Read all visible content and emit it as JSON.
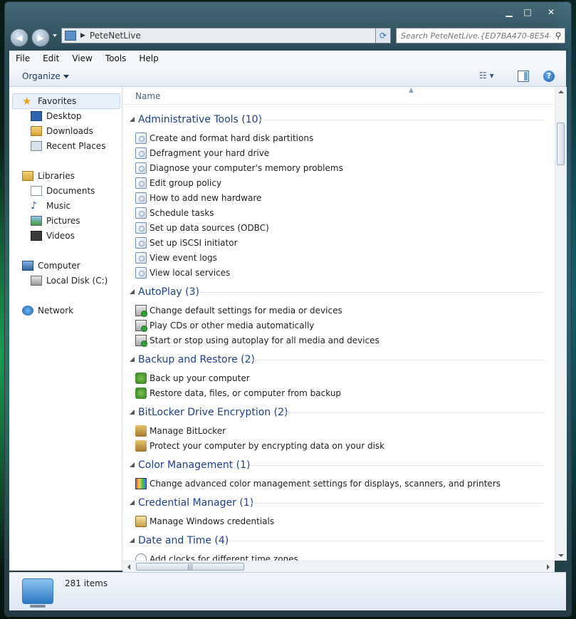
{
  "window": {
    "caption_buttons": {
      "minimize": "▁",
      "maximize": "□",
      "close": "✕"
    }
  },
  "navigation": {
    "back_label": "◀",
    "forward_label": "▶",
    "address": "PeteNetLive",
    "address_separator": "▶",
    "refresh_label": "⟳",
    "search_placeholder": "Search PeteNetLive.{ED7BA470-8E54-...",
    "search_icon": "⚲"
  },
  "menubar": {
    "items": [
      "File",
      "Edit",
      "View",
      "Tools",
      "Help"
    ]
  },
  "toolbar": {
    "organize_label": "Organize",
    "views_label": "☷ ▾",
    "help_label": "?"
  },
  "sidebar": {
    "favorites": "Favorites",
    "desktop": "Desktop",
    "downloads": "Downloads",
    "recent_places": "Recent Places",
    "libraries": "Libraries",
    "documents": "Documents",
    "music": "Music",
    "pictures": "Pictures",
    "videos": "Videos",
    "computer": "Computer",
    "local_disk": "Local Disk (C:)",
    "network": "Network"
  },
  "content": {
    "column_name": "Name",
    "groups": [
      {
        "title": "Administrative Tools (10)",
        "icon": "admin-tools-icon",
        "items": [
          "Create and format hard disk partitions",
          "Defragment your hard drive",
          "Diagnose your computer's memory problems",
          "Edit group policy",
          "How to add new hardware",
          "Schedule tasks",
          "Set up data sources (ODBC)",
          "Set up iSCSI initiator",
          "View event logs",
          "View local services"
        ]
      },
      {
        "title": "AutoPlay (3)",
        "icon": "autoplay-icon",
        "items": [
          "Change default settings for media or devices",
          "Play CDs or other media automatically",
          "Start or stop using autoplay for all media and devices"
        ]
      },
      {
        "title": "Backup and Restore (2)",
        "icon": "backup-icon",
        "items": [
          "Back up your computer",
          "Restore data, files, or computer from backup"
        ]
      },
      {
        "title": "BitLocker Drive Encryption (2)",
        "icon": "bitlocker-icon",
        "items": [
          "Manage BitLocker",
          "Protect your computer by encrypting data on your disk"
        ]
      },
      {
        "title": "Color Management (1)",
        "icon": "color-management-icon",
        "items": [
          "Change advanced color management settings for displays, scanners, and printers"
        ]
      },
      {
        "title": "Credential Manager (1)",
        "icon": "credential-icon",
        "items": [
          "Manage Windows credentials"
        ]
      },
      {
        "title": "Date and Time (4)",
        "icon": "clock-icon",
        "items": [
          "Add clocks for different time zones"
        ]
      }
    ]
  },
  "scrollbars": {
    "h_grip": "|||"
  },
  "status": {
    "count": "281 items"
  }
}
